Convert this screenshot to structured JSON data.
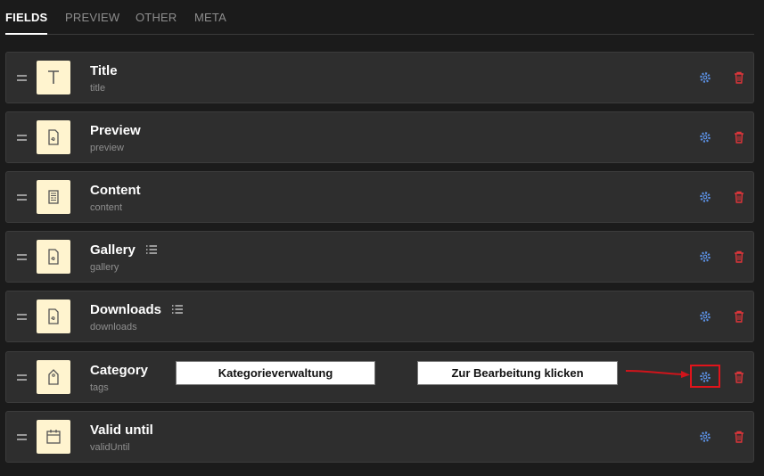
{
  "tabs": [
    {
      "label": "FIELDS",
      "active": true
    },
    {
      "label": "PREVIEW",
      "active": false
    },
    {
      "label": "OTHER",
      "active": false
    },
    {
      "label": "META",
      "active": false
    }
  ],
  "fields": [
    {
      "name": "Title",
      "key": "title",
      "icon": "text-type-icon",
      "list": false
    },
    {
      "name": "Preview",
      "key": "preview",
      "icon": "file-icon",
      "list": false
    },
    {
      "name": "Content",
      "key": "content",
      "icon": "document-icon",
      "list": false
    },
    {
      "name": "Gallery",
      "key": "gallery",
      "icon": "file-icon",
      "list": true
    },
    {
      "name": "Downloads",
      "key": "downloads",
      "icon": "file-icon",
      "list": true
    },
    {
      "name": "Category",
      "key": "tags",
      "icon": "tag-icon",
      "list": false
    },
    {
      "name": "Valid until",
      "key": "validUntil",
      "icon": "calendar-icon",
      "list": false
    }
  ],
  "annotations": {
    "category_label": "Kategorieverwaltung",
    "edit_hint": "Zur Bearbeitung klicken"
  },
  "colors": {
    "gear": "#5b8fe0",
    "trash": "#e0353a",
    "type_box": "#fff4cf",
    "highlight": "#e0141b"
  }
}
